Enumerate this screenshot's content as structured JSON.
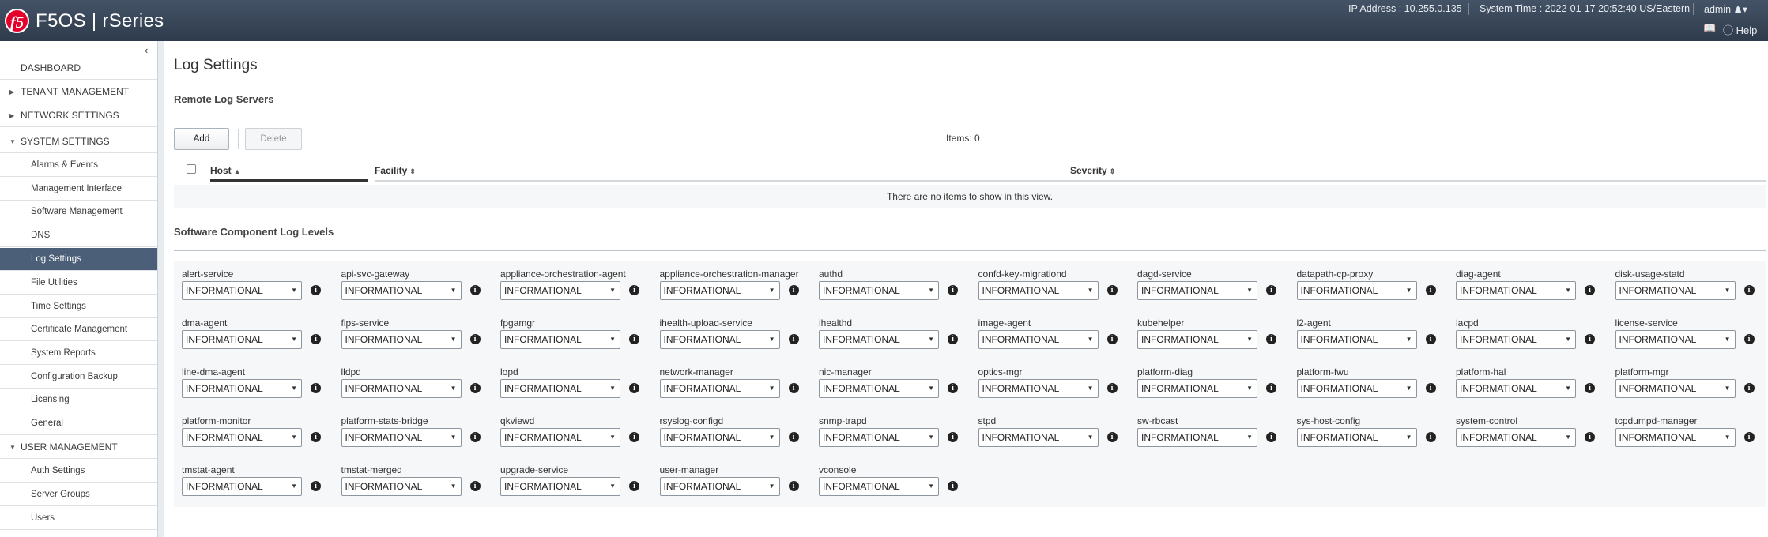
{
  "header": {
    "logo_text": "f5",
    "brand": "F5OS | rSeries",
    "ip_address": "IP Address : 10.255.0.135",
    "system_time": "System Time : 2022-01-17 20:52:40 US/Eastern",
    "user": "admin",
    "help_label": "Help"
  },
  "sidebar": {
    "items": [
      {
        "label": "DASHBOARD"
      },
      {
        "label": "TENANT MANAGEMENT"
      },
      {
        "label": "NETWORK SETTINGS"
      },
      {
        "label": "SYSTEM SETTINGS"
      },
      {
        "label": "Alarms & Events"
      },
      {
        "label": "Management Interface"
      },
      {
        "label": "Software Management"
      },
      {
        "label": "DNS"
      },
      {
        "label": "Log Settings"
      },
      {
        "label": "File Utilities"
      },
      {
        "label": "Time Settings"
      },
      {
        "label": "Certificate Management"
      },
      {
        "label": "System Reports"
      },
      {
        "label": "Configuration Backup"
      },
      {
        "label": "Licensing"
      },
      {
        "label": "General"
      },
      {
        "label": "USER MANAGEMENT"
      },
      {
        "label": "Auth Settings"
      },
      {
        "label": "Server Groups"
      },
      {
        "label": "Users"
      }
    ]
  },
  "main": {
    "page_title": "Log Settings",
    "remote_section_title": "Remote Log Servers",
    "add_label": "Add",
    "delete_label": "Delete",
    "items_count": "Items: 0",
    "columns": [
      "Host",
      "Facility",
      "Severity"
    ],
    "empty_text": "There are no items to show in this view.",
    "components_title": "Software Component Log Levels",
    "components": [
      {
        "name": "alert-service",
        "level": "INFORMATIONAL"
      },
      {
        "name": "api-svc-gateway",
        "level": "INFORMATIONAL"
      },
      {
        "name": "appliance-orchestration-agent",
        "level": "INFORMATIONAL"
      },
      {
        "name": "appliance-orchestration-manager",
        "level": "INFORMATIONAL"
      },
      {
        "name": "authd",
        "level": "INFORMATIONAL"
      },
      {
        "name": "confd-key-migrationd",
        "level": "INFORMATIONAL"
      },
      {
        "name": "dagd-service",
        "level": "INFORMATIONAL"
      },
      {
        "name": "datapath-cp-proxy",
        "level": "INFORMATIONAL"
      },
      {
        "name": "diag-agent",
        "level": "INFORMATIONAL"
      },
      {
        "name": "disk-usage-statd",
        "level": "INFORMATIONAL"
      },
      {
        "name": "dma-agent",
        "level": "INFORMATIONAL"
      },
      {
        "name": "fips-service",
        "level": "INFORMATIONAL"
      },
      {
        "name": "fpgamgr",
        "level": "INFORMATIONAL"
      },
      {
        "name": "ihealth-upload-service",
        "level": "INFORMATIONAL"
      },
      {
        "name": "ihealthd",
        "level": "INFORMATIONAL"
      },
      {
        "name": "image-agent",
        "level": "INFORMATIONAL"
      },
      {
        "name": "kubehelper",
        "level": "INFORMATIONAL"
      },
      {
        "name": "l2-agent",
        "level": "INFORMATIONAL"
      },
      {
        "name": "lacpd",
        "level": "INFORMATIONAL"
      },
      {
        "name": "license-service",
        "level": "INFORMATIONAL"
      },
      {
        "name": "line-dma-agent",
        "level": "INFORMATIONAL"
      },
      {
        "name": "lldpd",
        "level": "INFORMATIONAL"
      },
      {
        "name": "lopd",
        "level": "INFORMATIONAL"
      },
      {
        "name": "network-manager",
        "level": "INFORMATIONAL"
      },
      {
        "name": "nic-manager",
        "level": "INFORMATIONAL"
      },
      {
        "name": "optics-mgr",
        "level": "INFORMATIONAL"
      },
      {
        "name": "platform-diag",
        "level": "INFORMATIONAL"
      },
      {
        "name": "platform-fwu",
        "level": "INFORMATIONAL"
      },
      {
        "name": "platform-hal",
        "level": "INFORMATIONAL"
      },
      {
        "name": "platform-mgr",
        "level": "INFORMATIONAL"
      },
      {
        "name": "platform-monitor",
        "level": "INFORMATIONAL"
      },
      {
        "name": "platform-stats-bridge",
        "level": "INFORMATIONAL"
      },
      {
        "name": "qkviewd",
        "level": "INFORMATIONAL"
      },
      {
        "name": "rsyslog-configd",
        "level": "INFORMATIONAL"
      },
      {
        "name": "snmp-trapd",
        "level": "INFORMATIONAL"
      },
      {
        "name": "stpd",
        "level": "INFORMATIONAL"
      },
      {
        "name": "sw-rbcast",
        "level": "INFORMATIONAL"
      },
      {
        "name": "sys-host-config",
        "level": "INFORMATIONAL"
      },
      {
        "name": "system-control",
        "level": "INFORMATIONAL"
      },
      {
        "name": "tcpdumpd-manager",
        "level": "INFORMATIONAL"
      },
      {
        "name": "tmstat-agent",
        "level": "INFORMATIONAL"
      },
      {
        "name": "tmstat-merged",
        "level": "INFORMATIONAL"
      },
      {
        "name": "upgrade-service",
        "level": "INFORMATIONAL"
      },
      {
        "name": "user-manager",
        "level": "INFORMATIONAL"
      },
      {
        "name": "vconsole",
        "level": "INFORMATIONAL"
      }
    ]
  }
}
